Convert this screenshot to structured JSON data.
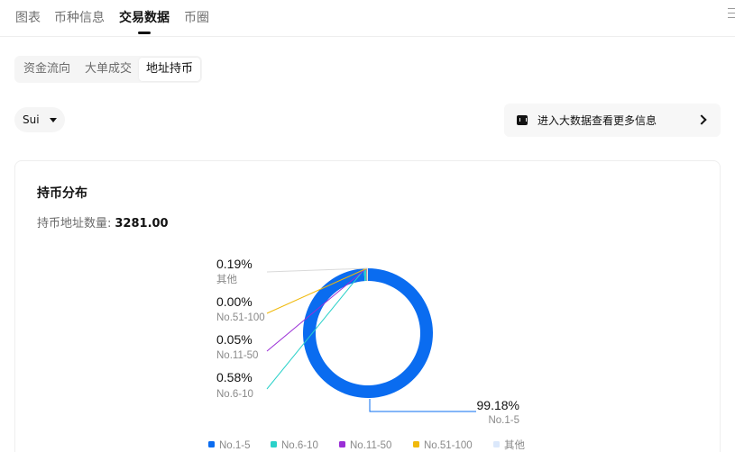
{
  "nav": {
    "tabs": [
      {
        "label": "图表"
      },
      {
        "label": "币种信息"
      },
      {
        "label": "交易数据"
      },
      {
        "label": "币圈"
      }
    ]
  },
  "sub_tabs": [
    {
      "label": "资金流向"
    },
    {
      "label": "大单成交"
    },
    {
      "label": "地址持币"
    }
  ],
  "coin_selector": {
    "value": "Sui"
  },
  "more_info": {
    "label": "进入大数据查看更多信息",
    "icon": "data-report-icon"
  },
  "card": {
    "title": "持币分布",
    "address_count_label": "持币地址数量:",
    "address_count_value": "3281.00"
  },
  "chart_data": {
    "type": "pie",
    "donut": true,
    "legend_position": "bottom",
    "slices": [
      {
        "name": "No.1-5",
        "value": 99.18,
        "label": "99.18%",
        "color": "#0a6cf0"
      },
      {
        "name": "No.6-10",
        "value": 0.58,
        "label": "0.58%",
        "color": "#2ad1c9"
      },
      {
        "name": "No.11-50",
        "value": 0.05,
        "label": "0.05%",
        "color": "#9a2ed6"
      },
      {
        "name": "No.51-100",
        "value": 0.0,
        "label": "0.00%",
        "color": "#f0b90b"
      },
      {
        "name": "其他",
        "value": 0.19,
        "label": "0.19%",
        "color": "#dbe8fb"
      }
    ]
  }
}
